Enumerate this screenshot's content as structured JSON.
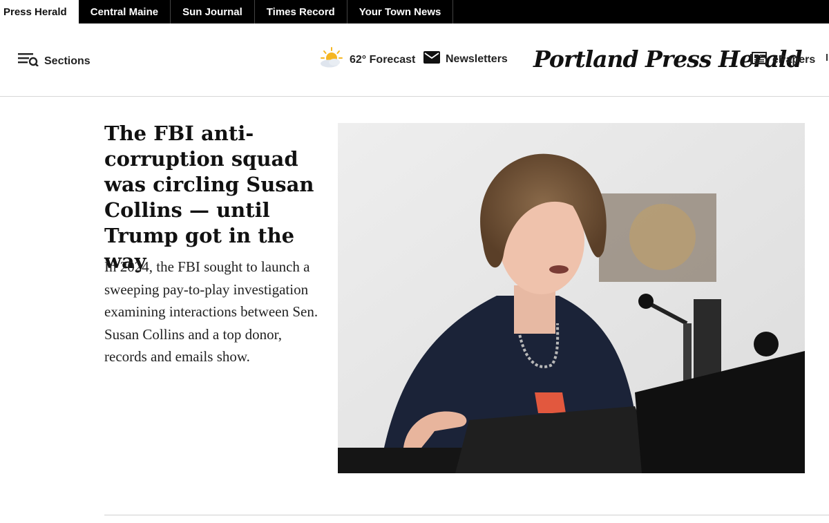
{
  "network": {
    "tabs": [
      "Press Herald",
      "Central Maine",
      "Sun Journal",
      "Times Record",
      "Your Town News"
    ],
    "active_index": 0
  },
  "masthead": {
    "sections_label": "Sections",
    "sections_icon": "menu-search-icon",
    "weather_icon": "partly-sunny-icon",
    "forecast_label": "62° Forecast",
    "newsletters_icon": "envelope-icon",
    "newsletters_label": "Newsletters",
    "logo_text": "Portland Press Herald",
    "epapers_icon": "newspaper-icon",
    "epapers_label": "ePapers"
  },
  "story": {
    "headline": "The FBI anti-corruption squad was circling Susan Collins — until Trump got in the way",
    "dek": "In 2024, the FBI sought to launch a sweeping pay-to-play investigation examining interactions between Sen. Susan Collins and a top donor, records and emails show.",
    "photo_description_icon": "photo"
  },
  "colors": {
    "topbar_bg": "#000000",
    "text": "#111111",
    "sun": "#f5b623",
    "divider": "#cfcfcf"
  }
}
